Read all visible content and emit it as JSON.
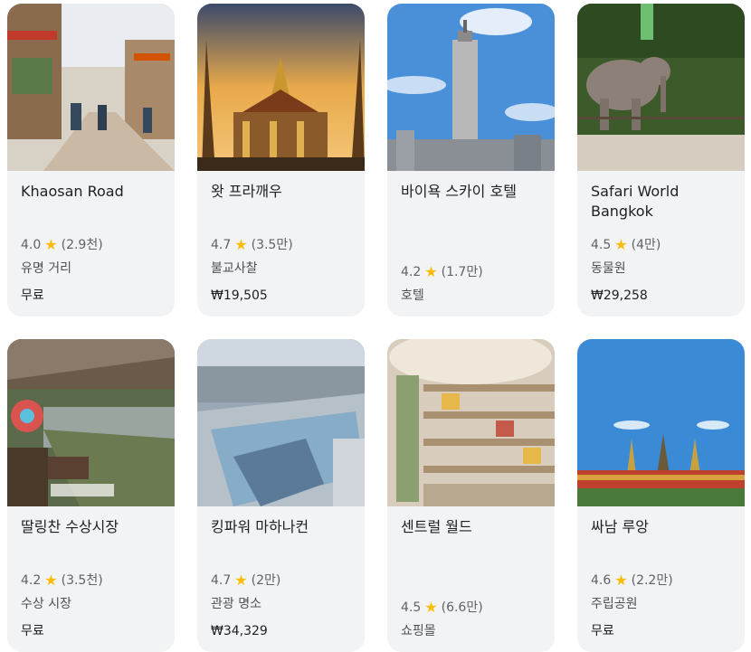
{
  "cards": [
    {
      "title": "Khaosan Road",
      "rating": "4.0",
      "reviews": "(2.9천)",
      "category": "유명 거리",
      "price": "무료"
    },
    {
      "title": "왓 프라깨우",
      "rating": "4.7",
      "reviews": "(3.5만)",
      "category": "불교사찰",
      "price": "₩19,505"
    },
    {
      "title": "바이욕 스카이 호텔",
      "rating": "4.2",
      "reviews": "(1.7만)",
      "category": "호텔",
      "price": ""
    },
    {
      "title": "Safari World Bangkok",
      "rating": "4.5",
      "reviews": "(4만)",
      "category": "동물원",
      "price": "₩29,258"
    },
    {
      "title": "딸링찬 수상시장",
      "rating": "4.2",
      "reviews": "(3.5천)",
      "category": "수상 시장",
      "price": "무료"
    },
    {
      "title": "킹파워 마하나컨",
      "rating": "4.7",
      "reviews": "(2만)",
      "category": "관광 명소",
      "price": "₩34,329"
    },
    {
      "title": "센트럴 월드",
      "rating": "4.5",
      "reviews": "(6.6만)",
      "category": "쇼핑몰",
      "price": ""
    },
    {
      "title": "싸남 루앙",
      "rating": "4.6",
      "reviews": "(2.2만)",
      "category": "주립공원",
      "price": "무료"
    }
  ],
  "star_glyph": "★",
  "colors": {
    "card_bg": "#f1f3f4",
    "star": "#fbbc04",
    "muted": "#5f6368"
  }
}
